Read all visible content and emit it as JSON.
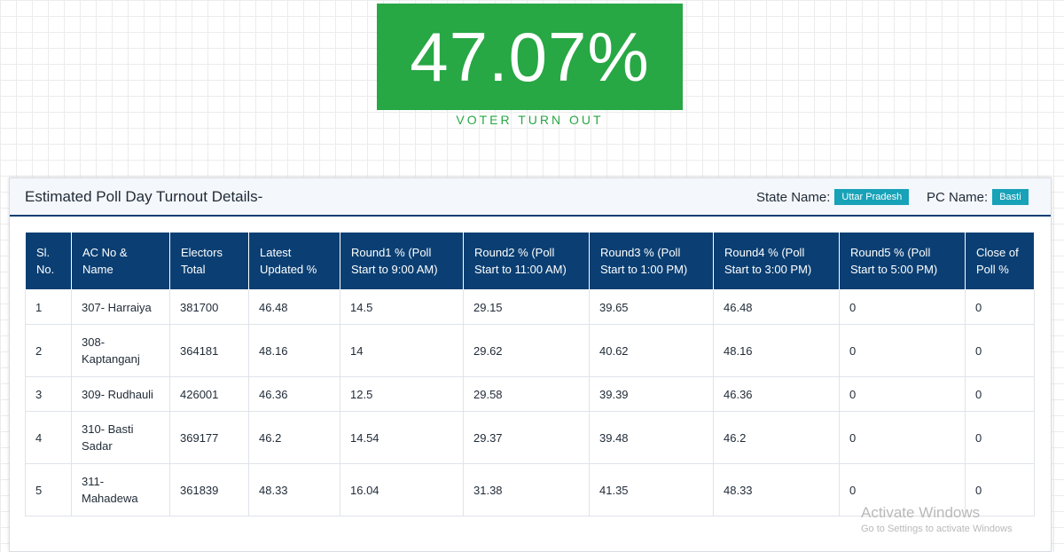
{
  "turnout": {
    "value": "47.07%",
    "label": "VOTER TURN OUT"
  },
  "card": {
    "title": "Estimated Poll Day Turnout Details-",
    "state_label": "State Name:",
    "state_value": "Uttar Pradesh",
    "pc_label": "PC Name:",
    "pc_value": "Basti"
  },
  "table": {
    "headers": [
      "Sl. No.",
      "AC No & Name",
      "Electors Total",
      "Latest Updated %",
      "Round1 % (Poll Start to 9:00 AM)",
      "Round2 % (Poll Start to 11:00 AM)",
      "Round3 % (Poll Start to 1:00 PM)",
      "Round4 % (Poll Start to 3:00 PM)",
      "Round5 % (Poll Start to 5:00 PM)",
      "Close of Poll %"
    ],
    "rows": [
      [
        "1",
        "307- Harraiya",
        "381700",
        "46.48",
        "14.5",
        "29.15",
        "39.65",
        "46.48",
        "0",
        "0"
      ],
      [
        "2",
        "308- Kaptanganj",
        "364181",
        "48.16",
        "14",
        "29.62",
        "40.62",
        "48.16",
        "0",
        "0"
      ],
      [
        "3",
        "309- Rudhauli",
        "426001",
        "46.36",
        "12.5",
        "29.58",
        "39.39",
        "46.36",
        "0",
        "0"
      ],
      [
        "4",
        "310- Basti Sadar",
        "369177",
        "46.2",
        "14.54",
        "29.37",
        "39.48",
        "46.2",
        "0",
        "0"
      ],
      [
        "5",
        "311- Mahadewa",
        "361839",
        "48.33",
        "16.04",
        "31.38",
        "41.35",
        "48.33",
        "0",
        "0"
      ]
    ]
  },
  "watermark": {
    "title": "Activate Windows",
    "subtitle": "Go to Settings to activate Windows"
  },
  "colors": {
    "accent_green": "#28a745",
    "header_navy": "#0b3f73",
    "badge_teal": "#17a2b8"
  }
}
